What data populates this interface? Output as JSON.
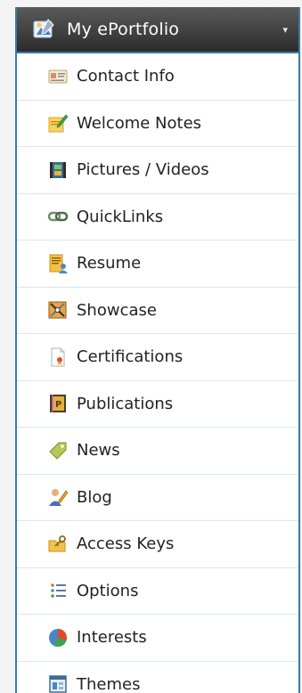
{
  "header": {
    "title": "My ePortfolio",
    "caret": "▾"
  },
  "menu": {
    "items": [
      {
        "label": "Contact Info"
      },
      {
        "label": "Welcome Notes"
      },
      {
        "label": "Pictures / Videos"
      },
      {
        "label": "QuickLinks"
      },
      {
        "label": "Resume"
      },
      {
        "label": "Showcase"
      },
      {
        "label": "Certifications"
      },
      {
        "label": "Publications"
      },
      {
        "label": "News"
      },
      {
        "label": "Blog"
      },
      {
        "label": "Access Keys"
      },
      {
        "label": "Options"
      },
      {
        "label": "Interests"
      },
      {
        "label": "Themes"
      }
    ]
  },
  "colors": {
    "header_bg": "#3a3a3a",
    "border": "#3a7ca5",
    "divider": "#dbe6ee",
    "text": "#222222"
  }
}
